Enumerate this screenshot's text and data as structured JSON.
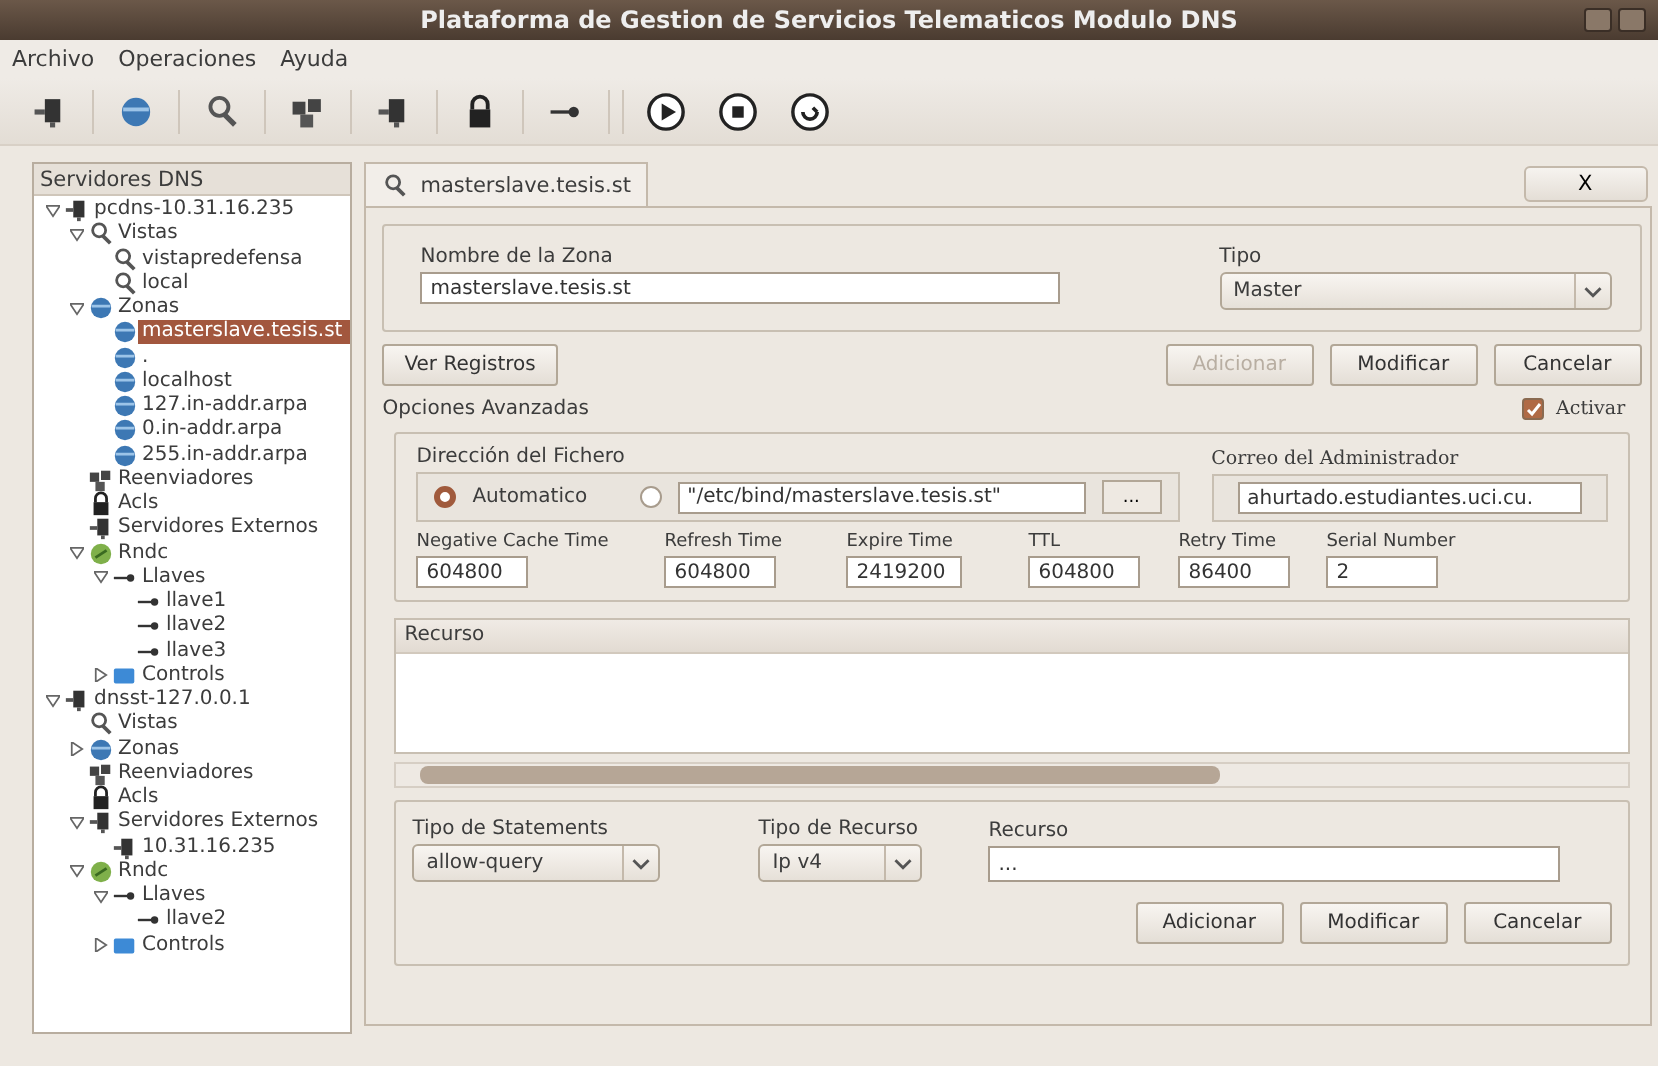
{
  "window": {
    "title": "Plataforma de Gestion de Servicios Telematicos Modulo DNS"
  },
  "menu": [
    "Archivo",
    "Operaciones",
    "Ayuda"
  ],
  "sidebar": {
    "title": "Servidores DNS",
    "tree": [
      {
        "label": "pcdns-10.31.16.235",
        "kind": "server",
        "expanded": true,
        "selected": false,
        "children": [
          {
            "label": "Vistas",
            "kind": "view",
            "expanded": true,
            "selected": false,
            "children": [
              {
                "label": "vistapredefensa",
                "kind": "view",
                "selected": false
              },
              {
                "label": "local",
                "kind": "view",
                "selected": false
              }
            ]
          },
          {
            "label": "Zonas",
            "kind": "zone",
            "expanded": true,
            "selected": false,
            "children": [
              {
                "label": "masterslave.tesis.st",
                "kind": "zone",
                "selected": true
              },
              {
                "label": ".",
                "kind": "zone",
                "selected": false
              },
              {
                "label": "localhost",
                "kind": "zone",
                "selected": false
              },
              {
                "label": "127.in-addr.arpa",
                "kind": "zone",
                "selected": false
              },
              {
                "label": "0.in-addr.arpa",
                "kind": "zone",
                "selected": false
              },
              {
                "label": "255.in-addr.arpa",
                "kind": "zone",
                "selected": false
              }
            ]
          },
          {
            "label": "Reenviadores",
            "kind": "forwarders",
            "selected": false
          },
          {
            "label": "Acls",
            "kind": "lock",
            "selected": false
          },
          {
            "label": "Servidores Externos",
            "kind": "server",
            "selected": false
          },
          {
            "label": "Rndc",
            "kind": "rndc",
            "expanded": true,
            "selected": false,
            "children": [
              {
                "label": "Llaves",
                "kind": "key",
                "expanded": true,
                "selected": false,
                "children": [
                  {
                    "label": "llave1",
                    "kind": "key",
                    "selected": false
                  },
                  {
                    "label": "llave2",
                    "kind": "key",
                    "selected": false
                  },
                  {
                    "label": "llave3",
                    "kind": "key",
                    "selected": false
                  }
                ]
              },
              {
                "label": "Controls",
                "kind": "controls",
                "expanded": false,
                "selected": false
              }
            ]
          }
        ]
      },
      {
        "label": "dnsst-127.0.0.1",
        "kind": "server",
        "expanded": true,
        "selected": false,
        "children": [
          {
            "label": "Vistas",
            "kind": "view",
            "selected": false
          },
          {
            "label": "Zonas",
            "kind": "zone",
            "expanded": false,
            "selected": false
          },
          {
            "label": "Reenviadores",
            "kind": "forwarders",
            "selected": false
          },
          {
            "label": "Acls",
            "kind": "lock",
            "selected": false
          },
          {
            "label": "Servidores Externos",
            "kind": "server",
            "expanded": true,
            "selected": false,
            "children": [
              {
                "label": "10.31.16.235",
                "kind": "server",
                "selected": false
              }
            ]
          },
          {
            "label": "Rndc",
            "kind": "rndc",
            "expanded": true,
            "selected": false,
            "children": [
              {
                "label": "Llaves",
                "kind": "key",
                "expanded": true,
                "selected": false,
                "children": [
                  {
                    "label": "llave2",
                    "kind": "key",
                    "selected": false
                  }
                ]
              },
              {
                "label": "Controls",
                "kind": "controls",
                "expanded": false,
                "selected": false
              }
            ]
          }
        ]
      }
    ]
  },
  "tab": {
    "label": "masterslave.tesis.st",
    "close": "X"
  },
  "zone": {
    "name_label": "Nombre de la Zona",
    "name": "masterslave.tesis.st",
    "type_label": "Tipo",
    "type": "Master"
  },
  "zone_buttons": {
    "view": "Ver Registros",
    "actions": [
      {
        "label": "Adicionar",
        "disabled": true
      },
      {
        "label": "Modificar",
        "disabled": false
      },
      {
        "label": "Cancelar",
        "disabled": false
      }
    ]
  },
  "advanced": {
    "title": "Opciones Avanzadas",
    "activate": {
      "label": "Activar",
      "checked": true
    },
    "file_label": "Dirección del Fichero",
    "auto": {
      "label": "Automatico",
      "selected": true
    },
    "custom": {
      "selected": false,
      "value": "\"/etc/bind/masterslave.tesis.st\"",
      "browse": "..."
    },
    "email_label": "Correo del Administrador",
    "email": "ahurtado.estudiantes.uci.cu.",
    "times": [
      {
        "label": "Negative Cache Time",
        "value": "604800"
      },
      {
        "label": "Refresh Time",
        "value": "604800"
      },
      {
        "label": "Expire Time",
        "value": "2419200"
      },
      {
        "label": "TTL",
        "value": "604800"
      },
      {
        "label": "Retry Time",
        "value": "86400"
      },
      {
        "label": "Serial Number",
        "value": "2"
      }
    ]
  },
  "table": {
    "columns": [
      "Recurso"
    ]
  },
  "resource": {
    "statement_label": "Tipo de Statements",
    "statement": "allow-query",
    "rtype_label": "Tipo de Recurso",
    "rtype": "Ip v4",
    "value_label": "Recurso",
    "value": "...",
    "actions": [
      {
        "label": "Adicionar",
        "disabled": false
      },
      {
        "label": "Modificar",
        "disabled": false
      },
      {
        "label": "Cancelar",
        "disabled": false
      }
    ]
  }
}
